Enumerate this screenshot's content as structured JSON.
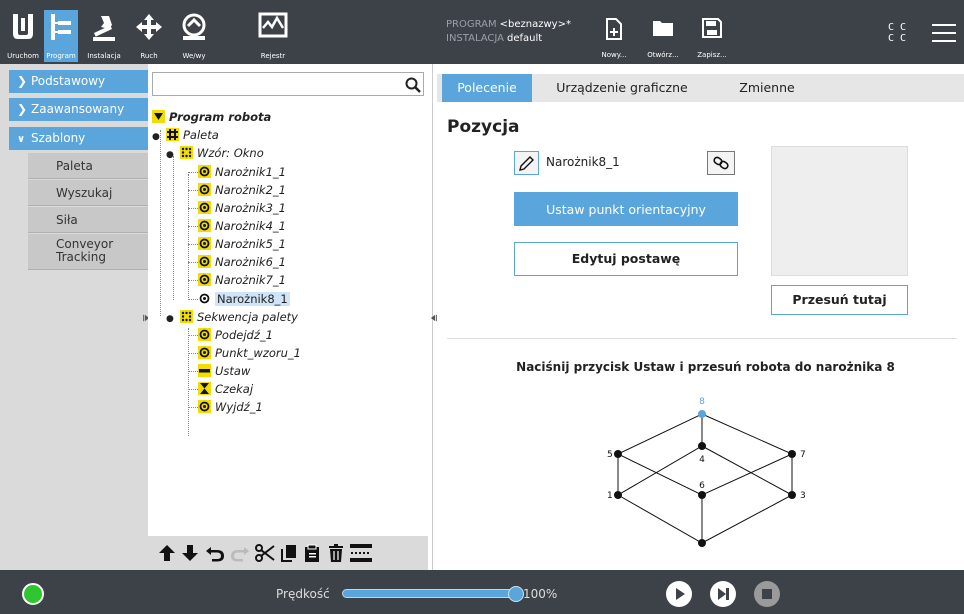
{
  "topbar": {
    "buttons": [
      {
        "label": "Uruchom",
        "icon": "ur-logo-icon"
      },
      {
        "label": "Program",
        "icon": "program-icon"
      },
      {
        "label": "Instalacja",
        "icon": "installation-icon"
      },
      {
        "label": "Ruch",
        "icon": "move-icon"
      },
      {
        "label": "We/wy",
        "icon": "io-icon"
      },
      {
        "label": "Rejestr",
        "icon": "log-icon"
      }
    ],
    "program_key": "PROGRAM",
    "program_value": "<beznazwy>*",
    "installation_key": "INSTALACJA",
    "installation_value": "default",
    "file_buttons": [
      {
        "label": "Nowy...",
        "icon": "new-file-icon"
      },
      {
        "label": "Otwórz...",
        "icon": "open-folder-icon"
      },
      {
        "label": "Zapisz...",
        "icon": "save-icon"
      }
    ],
    "cc_top": "C C",
    "cc_bottom": "C C"
  },
  "sidebar": {
    "categories": [
      {
        "label": "Podstawowy",
        "expanded": false
      },
      {
        "label": "Zaawansowany",
        "expanded": false
      },
      {
        "label": "Szablony",
        "expanded": true
      }
    ],
    "items": [
      "Paleta",
      "Wyszukaj",
      "Siła",
      "Conveyor Tracking"
    ]
  },
  "tree": {
    "search_placeholder": "",
    "root": "Program robota",
    "paleta": "Paleta",
    "pattern": "Wzór: Okno",
    "corners": [
      "Narożnik1_1",
      "Narożnik2_1",
      "Narożnik3_1",
      "Narożnik4_1",
      "Narożnik5_1",
      "Narożnik6_1",
      "Narożnik7_1",
      "Narożnik8_1"
    ],
    "sequence": "Sekwencja palety",
    "sequence_items": [
      "Podejdź_1",
      "Punkt_wzoru_1",
      "Ustaw",
      "Czekaj",
      "Wyjdź_1"
    ]
  },
  "tabs": [
    "Polecenie",
    "Urządzenie graficzne",
    "Zmienne"
  ],
  "main": {
    "title": "Pozycja",
    "pose_name": "Narożnik8_1",
    "set_button": "Ustaw punkt orientacyjny",
    "edit_button": "Edytuj postawę",
    "move_here_button": "Przesuń tutaj",
    "instruction": "Naciśnij przycisk Ustaw i przesuń robota do narożnika 8",
    "diagram_labels": {
      "p1": "1",
      "p3": "3",
      "p4": "4",
      "p5": "5",
      "p6": "6",
      "p7": "7",
      "p8": "8"
    }
  },
  "bottombar": {
    "speed_label": "Prędkość",
    "speed_value": "100%",
    "speed_fraction": 1.0
  },
  "colors": {
    "accent": "#5aa5dc",
    "bar": "#3d4148",
    "power_on": "#2ec62e",
    "node_yellow": "#f2dd00"
  }
}
